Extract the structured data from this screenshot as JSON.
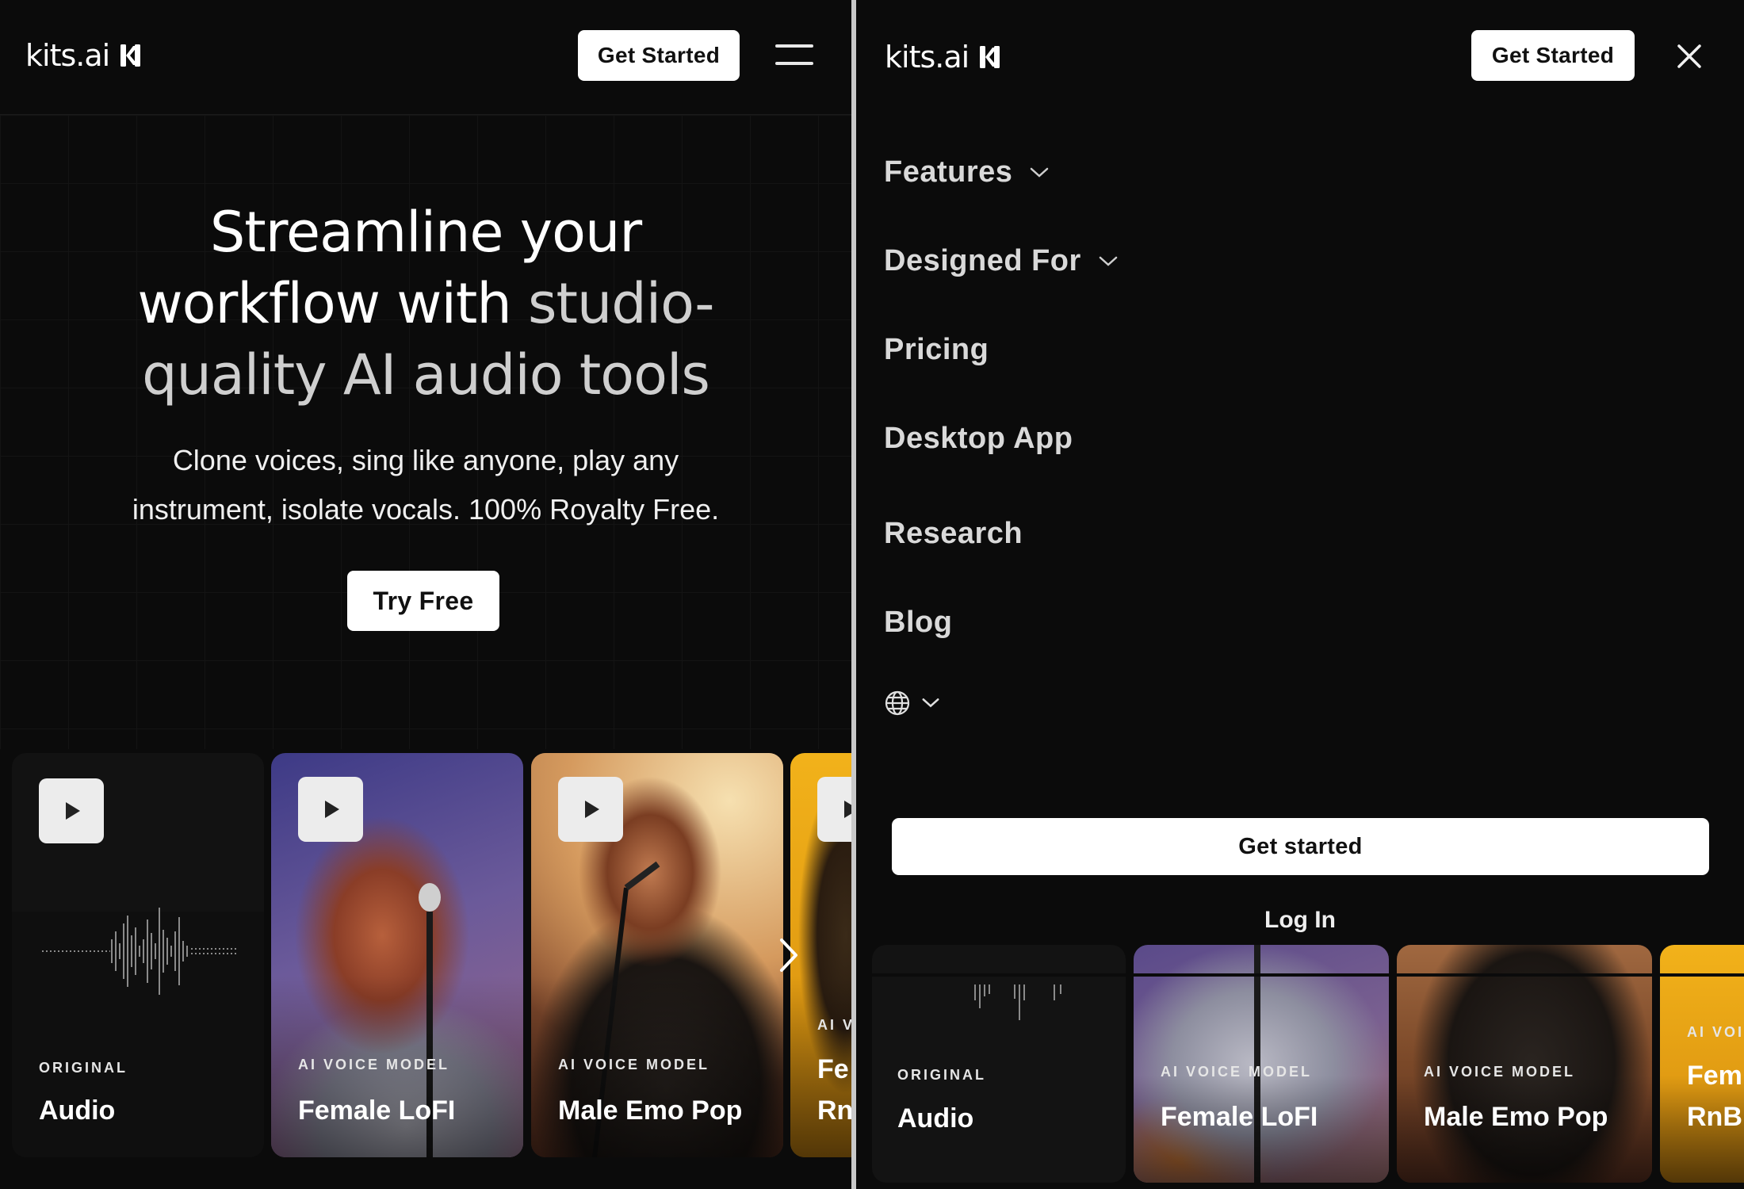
{
  "brand": {
    "name": "kits.ai"
  },
  "left_panel": {
    "header": {
      "cta_label": "Get Started"
    },
    "hero": {
      "title_line1": "Streamline your",
      "title_line2_a": "workflow with",
      "title_line2_b": "studio-",
      "title_line3_a": "quality AI",
      "title_line3_b": "audio tools",
      "subtitle_line1": "Clone voices, sing like anyone, play any",
      "subtitle_line2": "instrument, isolate vocals. 100% Royalty Free.",
      "cta_label": "Try Free"
    },
    "cards": [
      {
        "kicker": "ORIGINAL",
        "name": "Audio"
      },
      {
        "kicker": "AI VOICE MODEL",
        "name": "Female LoFI"
      },
      {
        "kicker": "AI VOICE MODEL",
        "name": "Male Emo Pop"
      },
      {
        "kicker": "AI V",
        "name": "Fe",
        "name2": "Rn"
      }
    ]
  },
  "right_panel": {
    "header": {
      "cta_label": "Get Started"
    },
    "menu": {
      "items": [
        {
          "label": "Features",
          "has_dropdown": true
        },
        {
          "label": "Designed For",
          "has_dropdown": true
        },
        {
          "label": "Pricing",
          "has_dropdown": false
        },
        {
          "label": "Desktop App",
          "has_dropdown": false
        },
        {
          "label": "Research",
          "has_dropdown": false
        },
        {
          "label": "Blog",
          "has_dropdown": false
        }
      ],
      "language_icon": "globe-icon",
      "primary_cta": "Get started",
      "secondary_cta": "Log In"
    },
    "cards": [
      {
        "kicker": "ORIGINAL",
        "name": "Audio"
      },
      {
        "kicker": "AI VOICE MODEL",
        "name": "Female LoFI"
      },
      {
        "kicker": "AI VOICE MODEL",
        "name": "Male Emo Pop"
      },
      {
        "kicker": "AI VOI",
        "name": "Fem",
        "name2": "RnB"
      }
    ]
  },
  "colors": {
    "background": "#0b0b0b",
    "button_bg": "#ffffff",
    "button_text": "#111111",
    "menu_text": "#d9d9d9"
  }
}
